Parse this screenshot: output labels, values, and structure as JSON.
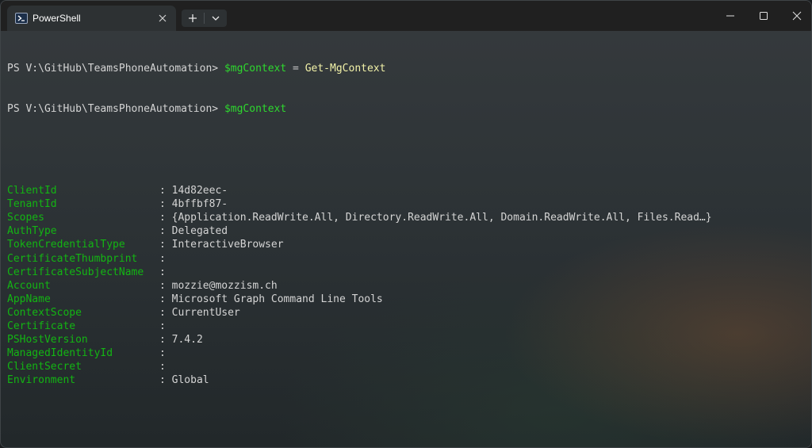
{
  "tab": {
    "title": "PowerShell",
    "icon": "powershell-icon"
  },
  "prompt": "PS V:\\GitHub\\TeamsPhoneAutomation>",
  "commands": [
    {
      "var": "$mgContext",
      "op": "=",
      "cmd": "Get-MgContext"
    },
    {
      "var": "$mgContext"
    }
  ],
  "properties": [
    {
      "key": "ClientId",
      "value": "14d82eec-"
    },
    {
      "key": "TenantId",
      "value": "4bffbf87-"
    },
    {
      "key": "Scopes",
      "value": "{Application.ReadWrite.All, Directory.ReadWrite.All, Domain.ReadWrite.All, Files.Read…}"
    },
    {
      "key": "AuthType",
      "value": "Delegated"
    },
    {
      "key": "TokenCredentialType",
      "value": "InteractiveBrowser"
    },
    {
      "key": "CertificateThumbprint",
      "value": ""
    },
    {
      "key": "CertificateSubjectName",
      "value": ""
    },
    {
      "key": "Account",
      "value": "mozzie@mozzism.ch"
    },
    {
      "key": "AppName",
      "value": "Microsoft Graph Command Line Tools"
    },
    {
      "key": "ContextScope",
      "value": "CurrentUser"
    },
    {
      "key": "Certificate",
      "value": ""
    },
    {
      "key": "PSHostVersion",
      "value": "7.4.2"
    },
    {
      "key": "ManagedIdentityId",
      "value": ""
    },
    {
      "key": "ClientSecret",
      "value": ""
    },
    {
      "key": "Environment",
      "value": "Global"
    }
  ],
  "separator": ":",
  "colors": {
    "variable": "#2ed82e",
    "command": "#f2f2a8",
    "property_key": "#13b513",
    "text": "#d4d4d4"
  }
}
